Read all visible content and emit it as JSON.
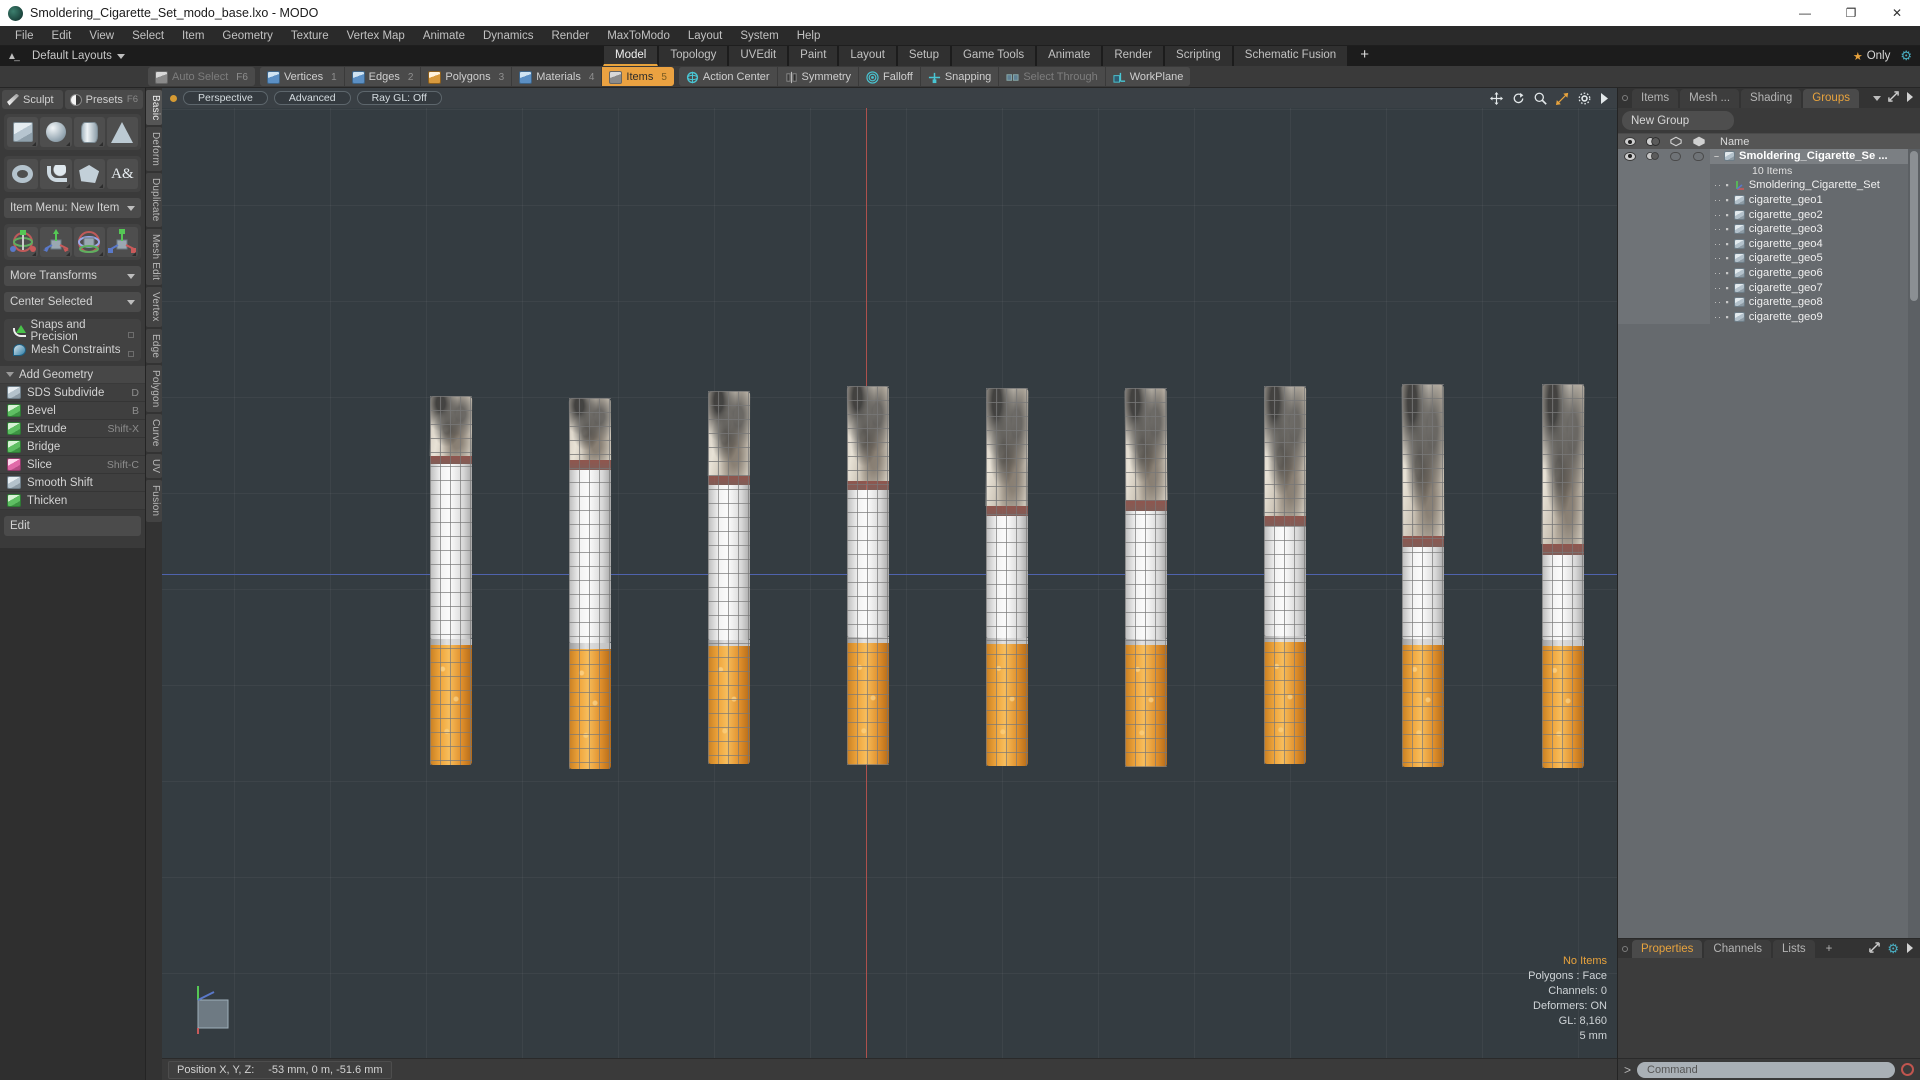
{
  "window": {
    "title": "Smoldering_Cigarette_Set_modo_base.lxo - MODO",
    "minimize": "—",
    "maximize": "❐",
    "close": "✕"
  },
  "menubar": {
    "items": [
      "File",
      "Edit",
      "View",
      "Select",
      "Item",
      "Geometry",
      "Texture",
      "Vertex Map",
      "Animate",
      "Dynamics",
      "Render",
      "MaxToModo",
      "Layout",
      "System",
      "Help"
    ]
  },
  "layoutbar": {
    "home_icon": "home-icon",
    "default_layouts": "Default Layouts",
    "tabs": [
      {
        "label": "Model",
        "active": true
      },
      {
        "label": "Topology",
        "active": false
      },
      {
        "label": "UVEdit",
        "active": false
      },
      {
        "label": "Paint",
        "active": false
      },
      {
        "label": "Layout",
        "active": false
      },
      {
        "label": "Setup",
        "active": false
      },
      {
        "label": "Game Tools",
        "active": false
      },
      {
        "label": "Animate",
        "active": false
      },
      {
        "label": "Render",
        "active": false
      },
      {
        "label": "Scripting",
        "active": false
      },
      {
        "label": "Schematic Fusion",
        "active": false
      }
    ],
    "add_tab": "+",
    "only_label": "Only",
    "star_icon": "star-icon",
    "gear_icon": "gear-icon"
  },
  "modebar": {
    "groups": [
      [
        {
          "label": "Auto Select",
          "num": "F6",
          "dim": true,
          "sel": false,
          "icon": "cube-gray"
        }
      ],
      [
        {
          "label": "Vertices",
          "num": "1",
          "dim": false,
          "sel": false,
          "icon": "cube-blue"
        },
        {
          "label": "Edges",
          "num": "2",
          "dim": false,
          "sel": false,
          "icon": "cube-blue"
        },
        {
          "label": "Polygons",
          "num": "3",
          "dim": false,
          "sel": false,
          "icon": "cube-or"
        },
        {
          "label": "Materials",
          "num": "4",
          "dim": false,
          "sel": false,
          "icon": "cube-blue"
        },
        {
          "label": "Items",
          "num": "5",
          "dim": false,
          "sel": true,
          "icon": "cube-gray"
        }
      ],
      [
        {
          "label": "Action Center",
          "num": "",
          "dim": false,
          "sel": false,
          "icon": "target"
        },
        {
          "label": "Symmetry",
          "num": "",
          "dim": false,
          "sel": false,
          "icon": "symmetry"
        },
        {
          "label": "Falloff",
          "num": "",
          "dim": false,
          "sel": false,
          "icon": "falloff"
        },
        {
          "label": "Snapping",
          "num": "",
          "dim": false,
          "sel": false,
          "icon": "snap"
        },
        {
          "label": "Select Through",
          "num": "",
          "dim": true,
          "sel": false,
          "icon": "through"
        },
        {
          "label": "WorkPlane",
          "num": "",
          "dim": false,
          "sel": false,
          "icon": "workplane"
        }
      ]
    ]
  },
  "leftpanel": {
    "tabs": [
      {
        "label": "Sculpt",
        "shortcut": "",
        "icon": "brush-icon"
      },
      {
        "label": "Presets",
        "shortcut": "F6",
        "icon": "presets-icon"
      }
    ],
    "primitives_row1": [
      "cube-shape",
      "sphere-shape",
      "cylinder-shape",
      "cone-shape"
    ],
    "primitives_row2": [
      "torus-shape",
      "curve-shape",
      "polygon-shape",
      "text-shape"
    ],
    "item_menu": "Item Menu: New Item",
    "transform_tools": [
      "transform-all",
      "move-tool",
      "rotate-tool",
      "scale-tool"
    ],
    "more_transforms": "More Transforms",
    "center_selected": "Center Selected",
    "snaps": "Snaps and Precision",
    "mesh_constraints": "Mesh Constraints",
    "add_geometry_header": "Add Geometry",
    "geometry_tools": [
      {
        "label": "SDS Subdivide",
        "shortcut": "D",
        "icon": "sds-icon"
      },
      {
        "label": "Bevel",
        "shortcut": "B",
        "icon": "bevel-icon"
      },
      {
        "label": "Extrude",
        "shortcut": "Shift-X",
        "icon": "extrude-icon"
      },
      {
        "label": "Bridge",
        "shortcut": "",
        "icon": "bridge-icon"
      },
      {
        "label": "Slice",
        "shortcut": "Shift-C",
        "icon": "slice-icon"
      },
      {
        "label": "Smooth Shift",
        "shortcut": "",
        "icon": "smooth-shift-icon"
      },
      {
        "label": "Thicken",
        "shortcut": "",
        "icon": "thicken-icon"
      }
    ],
    "edit_dropdown": "Edit"
  },
  "vstrip": {
    "tabs": [
      {
        "label": "Basic",
        "active": true
      },
      {
        "label": "Deform",
        "active": false
      },
      {
        "label": "Duplicate",
        "active": false
      },
      {
        "label": "Mesh Edit",
        "active": false
      },
      {
        "label": "Vertex",
        "active": false
      },
      {
        "label": "Edge",
        "active": false
      },
      {
        "label": "Polygon",
        "active": false
      },
      {
        "label": "Curve",
        "active": false
      },
      {
        "label": "UV",
        "active": false
      },
      {
        "label": "Fusion",
        "active": false
      }
    ]
  },
  "viewport": {
    "header_pills": [
      "Perspective",
      "Advanced",
      "Ray GL: Off"
    ],
    "icons": [
      "move-icon",
      "rotate-icon",
      "zoom-icon",
      "fit-icon",
      "gear-icon",
      "chevron-right-icon"
    ],
    "stats": {
      "selection": "No Items",
      "polygons": "Polygons : Face",
      "channels": "Channels: 0",
      "deformers": "Deformers: ON",
      "gl": "GL: 8,160",
      "grid": "5 mm"
    },
    "statusbar": {
      "label": "Position X, Y, Z:",
      "value": "-53 mm, 0 m, -51.6 mm"
    },
    "cigarette_count": 9
  },
  "rightpanel": {
    "tabs": [
      {
        "label": "Items",
        "active": false
      },
      {
        "label": "Mesh ...",
        "active": false
      },
      {
        "label": "Shading",
        "active": false
      },
      {
        "label": "Groups",
        "active": true
      }
    ],
    "new_group": "New Group",
    "tree_header": {
      "columns": [
        "visible-icon",
        "shading-icon",
        "render-icon",
        "wire-icon"
      ],
      "name": "Name"
    },
    "tree": [
      {
        "label": "Smoldering_Cigarette_Se ...",
        "type": "group",
        "bold": true,
        "selected": true,
        "indent": 0
      },
      {
        "label": "10 Items",
        "type": "count",
        "bold": false,
        "selected": false,
        "indent": 0
      },
      {
        "label": "Smoldering_Cigarette_Set",
        "type": "locator",
        "bold": false,
        "selected": false,
        "indent": 1
      },
      {
        "label": "cigarette_geo1",
        "type": "mesh",
        "bold": false,
        "selected": false,
        "indent": 1
      },
      {
        "label": "cigarette_geo2",
        "type": "mesh",
        "bold": false,
        "selected": false,
        "indent": 1
      },
      {
        "label": "cigarette_geo3",
        "type": "mesh",
        "bold": false,
        "selected": false,
        "indent": 1
      },
      {
        "label": "cigarette_geo4",
        "type": "mesh",
        "bold": false,
        "selected": false,
        "indent": 1
      },
      {
        "label": "cigarette_geo5",
        "type": "mesh",
        "bold": false,
        "selected": false,
        "indent": 1
      },
      {
        "label": "cigarette_geo6",
        "type": "mesh",
        "bold": false,
        "selected": false,
        "indent": 1
      },
      {
        "label": "cigarette_geo7",
        "type": "mesh",
        "bold": false,
        "selected": false,
        "indent": 1
      },
      {
        "label": "cigarette_geo8",
        "type": "mesh",
        "bold": false,
        "selected": false,
        "indent": 1
      },
      {
        "label": "cigarette_geo9",
        "type": "mesh",
        "bold": false,
        "selected": false,
        "indent": 1
      }
    ],
    "bottom_tabs": [
      {
        "label": "Properties",
        "active": true
      },
      {
        "label": "Channels",
        "active": false
      },
      {
        "label": "Lists",
        "active": false
      }
    ],
    "bottom_add": "+",
    "command_placeholder": "Command",
    "command_prompt": ">"
  },
  "colors": {
    "accent": "#e8a33d",
    "selected_tab": "#eba241",
    "viewport_bg": "#343c41",
    "axis_x": "#b4524e",
    "axis_z": "#4f63ad",
    "panel_bg": "#3a3a3a"
  }
}
